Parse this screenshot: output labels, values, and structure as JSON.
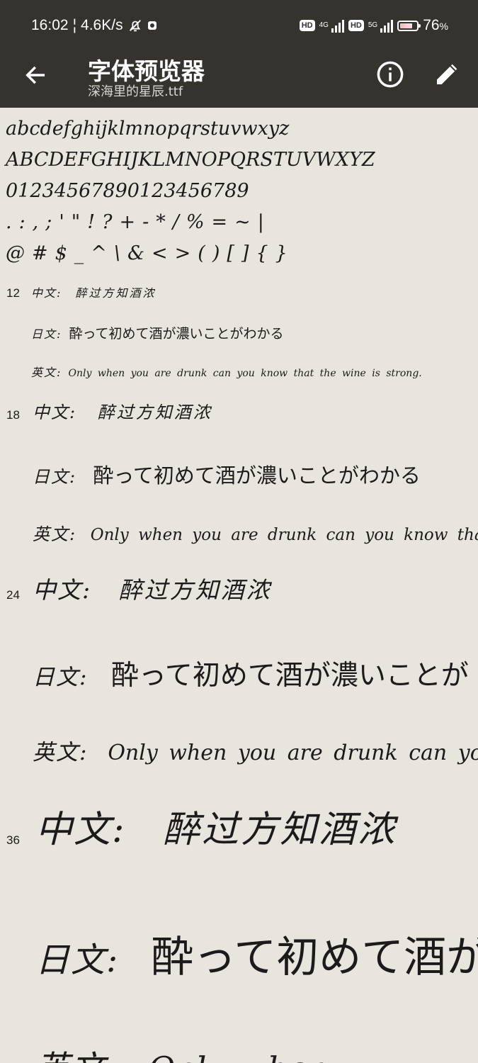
{
  "status_bar": {
    "time": "16:02",
    "separator": "¦",
    "speed": "4.6K/s",
    "hd1": "HD",
    "net1": "4G",
    "hd2": "HD",
    "net2": "5G",
    "battery_percent": "76",
    "battery_unit": "%",
    "battery_level": 0.76
  },
  "app_bar": {
    "title": "字体预览器",
    "subtitle": "深海里的星辰.ttf",
    "back_icon": "arrow-left-icon",
    "info_icon": "info-icon",
    "edit_icon": "pencil-icon"
  },
  "charset": {
    "lowercase": "abcdefghijklmnopqrstuvwxyz",
    "uppercase": "ABCDEFGHIJKLMNOPQRSTUVWXYZ",
    "digits": "01234567890123456789",
    "punct1": ".:,;'\"!?+-*/%=~|",
    "punct2": "@#$_^\\&<>()[]{}"
  },
  "samples": [
    {
      "size": "12",
      "cn_label": "中文:",
      "cn_text": "醉过方知酒浓",
      "jp_label": "日文:",
      "jp_text": "酔って初めて酒が濃いことがわかる",
      "en_label": "英文:",
      "en_text": "Only when you are drunk can you know that the wine is strong."
    },
    {
      "size": "18",
      "cn_label": "中文:",
      "cn_text": "醉过方知酒浓",
      "jp_label": "日文:",
      "jp_text": "酔って初めて酒が濃いことがわかる",
      "en_label": "英文:",
      "en_text": "Only when you are drunk can you know that th"
    },
    {
      "size": "24",
      "cn_label": "中文:",
      "cn_text": "醉过方知酒浓",
      "jp_label": "日文:",
      "jp_text": "酔って初めて酒が濃いことが",
      "en_label": "英文:",
      "en_text": "Only when you are drunk can you"
    },
    {
      "size": "36",
      "cn_label": "中文:",
      "cn_text": "醉过方知酒浓",
      "jp_label": "日文:",
      "jp_text": "酔って初めて酒が",
      "en_label": "英文:",
      "en_text": "Only when"
    }
  ],
  "colors": {
    "app_bar": "#35332e",
    "background": "#e8e5de",
    "text": "#1c1b1a"
  }
}
